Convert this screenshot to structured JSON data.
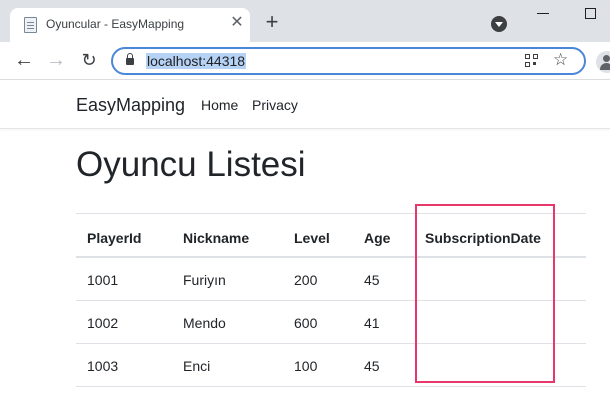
{
  "browser": {
    "tab_title": "Oyuncular - EasyMapping",
    "tab_close": "✕",
    "new_tab": "+",
    "url": "localhost:44318",
    "nav_back": "←",
    "nav_forward": "→",
    "nav_reload": "↻",
    "bookmark_star": "☆",
    "icons": [
      "document-icon",
      "close-icon",
      "plus-icon",
      "tab-search-icon",
      "minimize-icon",
      "maximize-icon",
      "back-arrow-icon",
      "forward-arrow-icon",
      "reload-icon",
      "lock-icon",
      "qr-code-icon",
      "star-icon",
      "profile-icon"
    ]
  },
  "site": {
    "brand": "EasyMapping",
    "nav": [
      "Home",
      "Privacy"
    ]
  },
  "page": {
    "title": "Oyuncu Listesi"
  },
  "table": {
    "columns": [
      "PlayerId",
      "Nickname",
      "Level",
      "Age",
      "SubscriptionDate"
    ],
    "rows": [
      [
        "1001",
        "Furiyın",
        "200",
        "45",
        ""
      ],
      [
        "1002",
        "Mendo",
        "600",
        "41",
        ""
      ],
      [
        "1003",
        "Enci",
        "100",
        "45",
        ""
      ]
    ]
  },
  "colors": {
    "highlight_border": "#e8376a",
    "omnibox_focus": "#4a87d8",
    "url_selection": "#b6d3f6",
    "tabstrip": "#dee1e6"
  }
}
